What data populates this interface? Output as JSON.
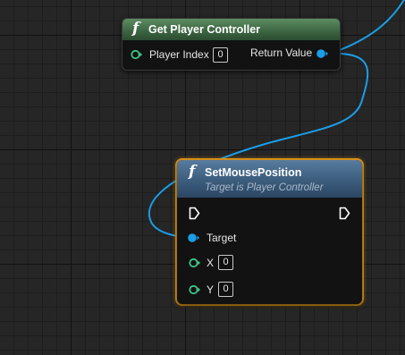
{
  "graph": {
    "background": "#262626",
    "wire_color": "#1b9ee6"
  },
  "get_player_controller": {
    "icon": "function-icon",
    "icon_glyph": "f",
    "title": "Get Player Controller",
    "header_color": "#3b6441",
    "input": {
      "label": "Player Index",
      "value": "0",
      "pin_color": "#3ec48a"
    },
    "output": {
      "label": "Return Value",
      "pin_color": "#1b9ee6"
    }
  },
  "set_mouse_position": {
    "icon": "function-icon",
    "icon_glyph": "f",
    "title": "SetMousePosition",
    "subtitle": "Target is Player Controller",
    "header_color": "#3e5f80",
    "selected_border_color": "#f0a21c",
    "pins": {
      "target": {
        "label": "Target",
        "pin_color": "#1b9ee6"
      },
      "x": {
        "label": "X",
        "value": "0",
        "pin_color": "#3ec48a"
      },
      "y": {
        "label": "Y",
        "value": "0",
        "pin_color": "#3ec48a"
      }
    }
  }
}
